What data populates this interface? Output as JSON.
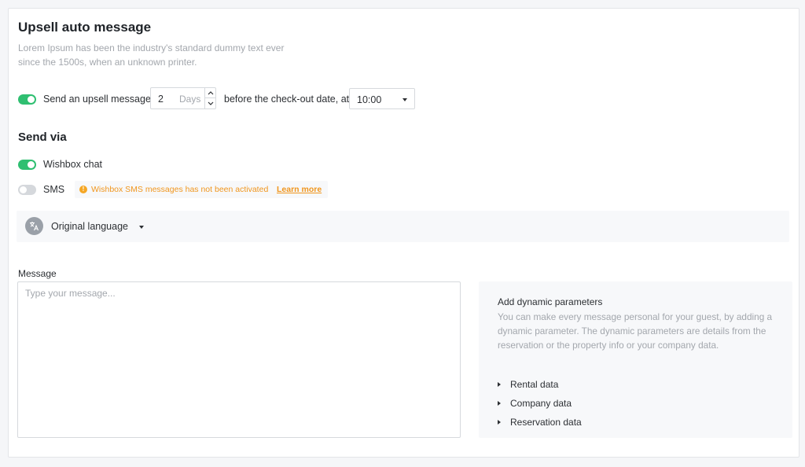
{
  "header": {
    "title": "Upsell auto message",
    "description": "Lorem Ipsum has been the industry's standard dummy text ever since the 1500s, when an unknown printer."
  },
  "upsell": {
    "enabled": true,
    "label": "Send an upsell message",
    "days_value": "2",
    "days_unit": "Days",
    "suffix": "before the check-out date, at",
    "time_value": "10:00"
  },
  "send_via": {
    "title": "Send via",
    "wishbox_chat": {
      "label": "Wishbox chat",
      "enabled": true
    },
    "sms": {
      "label": "SMS",
      "enabled": false,
      "warning": "Wishbox SMS messages has not been activated",
      "learn_more": "Learn more"
    }
  },
  "language": {
    "label": "Original language",
    "icon": "translate-icon"
  },
  "message": {
    "label": "Message",
    "placeholder": "Type your message..."
  },
  "dynamic": {
    "title": "Add dynamic parameters",
    "description": "You can make every message personal for your guest, by adding a dynamic parameter. The dynamic parameters are details from the reservation or the property info or your company data.",
    "items": [
      "Rental data",
      "Company data",
      "Reservation data"
    ]
  },
  "colors": {
    "toggle_on": "#2fbf71",
    "toggle_off": "#d5d8dc",
    "warning": "#f0961e"
  }
}
